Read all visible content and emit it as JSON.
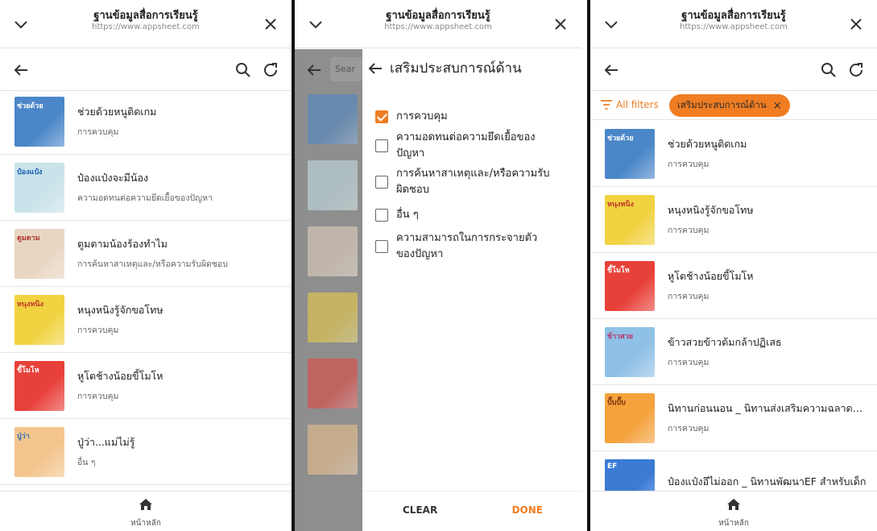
{
  "app": {
    "title": "ฐานข้อมูลสื่อการเรียนรู้",
    "url": "https://www.appsheet.com",
    "nav_home_label": "หน้าหลัก"
  },
  "panel1": {
    "items": [
      {
        "title": "ช่วยด้วยหนูติดเกม",
        "category": "การควบคุม",
        "thumb_caption": "ช่วยด้วย",
        "thumb_color": "#4a86c8"
      },
      {
        "title": "ป๋องแป๋งจะมีน้อง",
        "category": "ความอดทนต่อความยึดเยื้อของปัญหา",
        "thumb_caption": "ป๋องแป๋ง",
        "thumb_color": "#c9e3ea"
      },
      {
        "title": "ตูมตามน้องร้องทำไม",
        "category": "การค้นหาสาเหตุและ/หรือความรับผิดชอบ",
        "thumb_caption": "ตูมตาม",
        "thumb_color": "#e9d6c2"
      },
      {
        "title": "หนุงหนิงรู้จักขอโทษ",
        "category": "การควบคุม",
        "thumb_caption": "หนุงหนิง",
        "thumb_color": "#f1d241"
      },
      {
        "title": "หูโตช้างน้อยขี้โมโห",
        "category": "การควบคุม",
        "thumb_caption": "ขี้โมโห",
        "thumb_color": "#e8413a"
      },
      {
        "title": "ปู่ว่า...แม่ไม่รู้",
        "category": "อื่น ๆ",
        "thumb_caption": "ปู่ว่า",
        "thumb_color": "#f3c58d"
      }
    ]
  },
  "panel2": {
    "search_placeholder": "Sear",
    "sheet_title": "เสริมประสบการณ์ด้าน",
    "options": [
      {
        "label_lines": [
          "การควบคุม"
        ],
        "checked": true
      },
      {
        "label_lines": [
          "ความอดทนต่อความยึดเยื้อของ",
          "ปัญหา"
        ],
        "checked": false
      },
      {
        "label_lines": [
          "การค้นหาสาเหตุและ/หรือความรับ",
          "ผิดชอบ"
        ],
        "checked": false
      },
      {
        "label_lines": [
          "อื่น ๆ"
        ],
        "checked": false
      },
      {
        "label_lines": [
          "ความสามารถในการกระจายตัว",
          "ของปัญหา"
        ],
        "checked": false
      }
    ],
    "clear_label": "CLEAR",
    "done_label": "DONE"
  },
  "panel3": {
    "all_filters_label": "All filters",
    "chip_label": "เสริมประสบการณ์ด้าน",
    "chip_close": "×",
    "items": [
      {
        "title": "ช่วยด้วยหนูติดเกม",
        "category": "การควบคุม",
        "thumb_caption": "ช่วยด้วย",
        "thumb_color": "#4a86c8"
      },
      {
        "title": "หนุงหนิงรู้จักขอโทษ",
        "category": "การควบคุม",
        "thumb_caption": "หนุงหนิง",
        "thumb_color": "#f1d241"
      },
      {
        "title": "หูโตช้างน้อยขี้โมโห",
        "category": "การควบคุม",
        "thumb_caption": "ขี้โมโห",
        "thumb_color": "#e8413a"
      },
      {
        "title": "ข้าวสวยข้าวต้มกล้าปฏิเสธ",
        "category": "การควบคุม",
        "thumb_caption": "ข้าวสวย",
        "thumb_color": "#8fc1e6"
      },
      {
        "title": "นิทานก่อนนอน _ นิทานส่งเสริมความฉลาดทางสัง...",
        "category": "การควบคุม",
        "thumb_caption": "ปั๊บปั๊บ",
        "thumb_color": "#f4a23c"
      },
      {
        "title": "ป๋องแป๋งอึไม่ออก _ นิทานพัฒนาEF สำหรับเด็ก",
        "category": "",
        "thumb_caption": "EF",
        "thumb_color": "#3b7bd4"
      }
    ]
  },
  "colors": {
    "accent": "#f07d22",
    "overlay": "#8e8e8e"
  },
  "icons": [
    "chevron-down-icon",
    "close-icon",
    "back-arrow-icon",
    "search-icon",
    "refresh-icon",
    "home-icon",
    "filter-icon",
    "checkbox-icon"
  ]
}
